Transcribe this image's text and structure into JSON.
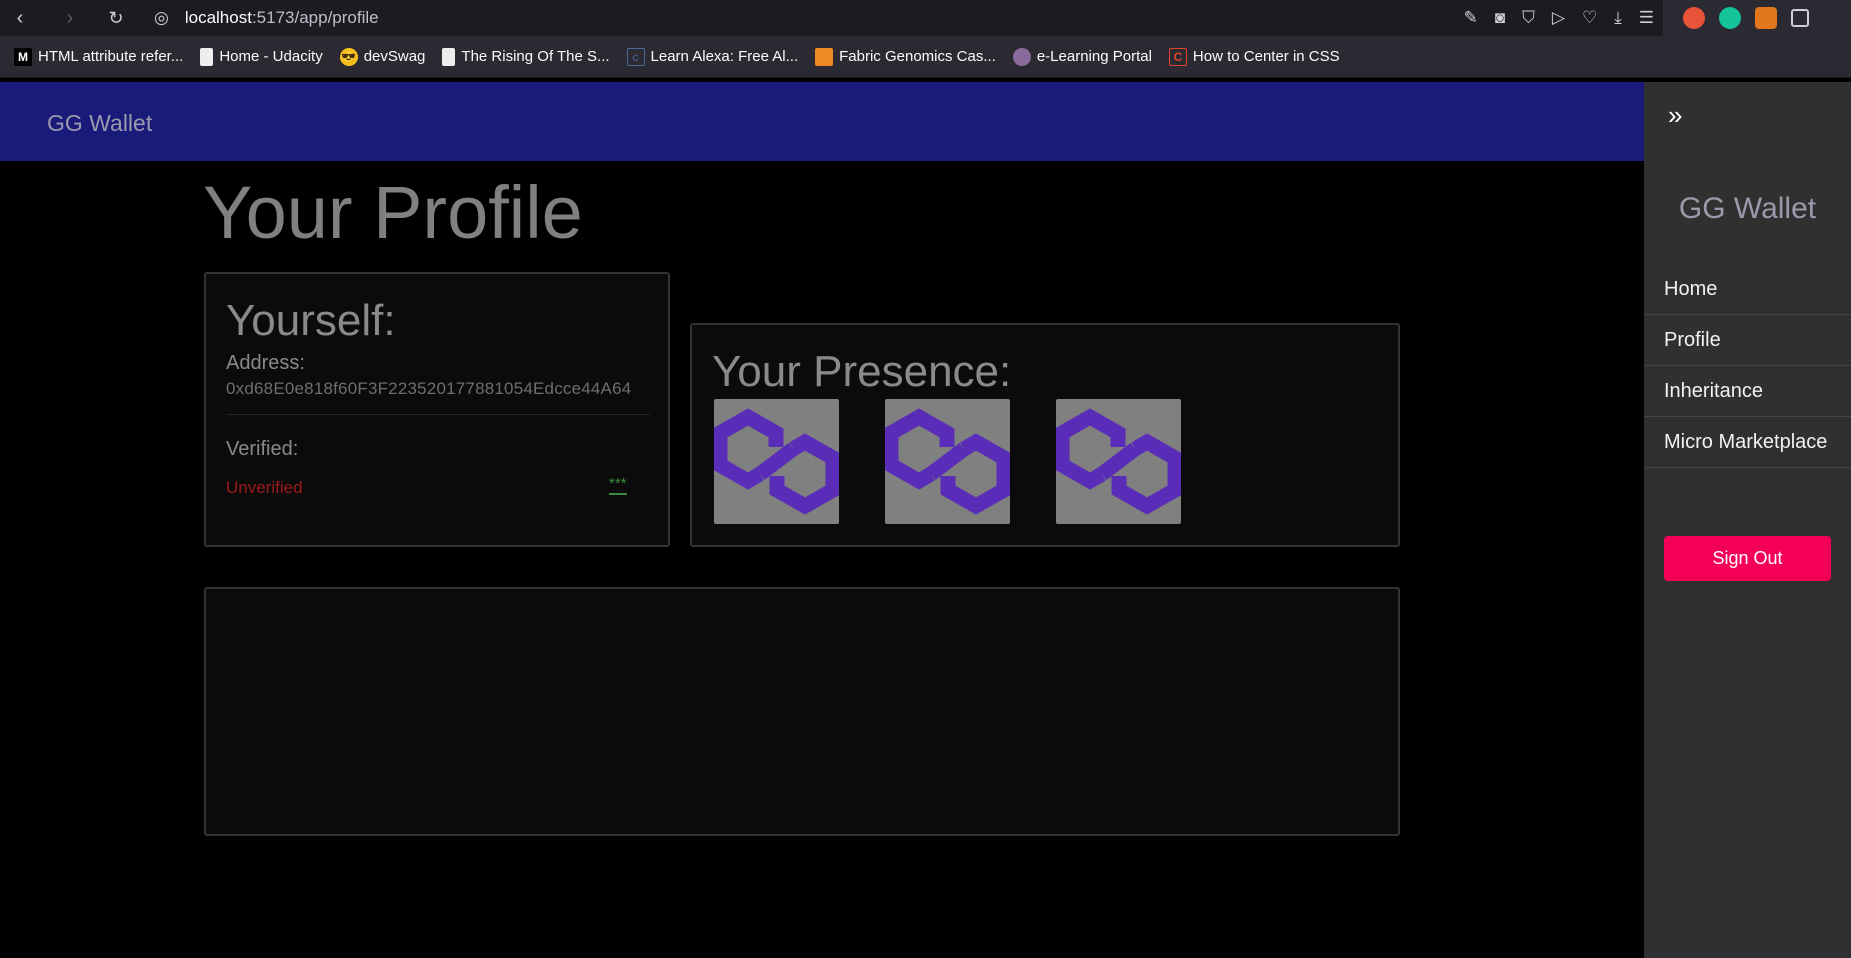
{
  "browser": {
    "url_host": "localhost",
    "url_path": ":5173/app/profile",
    "bookmarks": [
      "HTML attribute refer...",
      "Home - Udacity",
      "devSwag",
      "The Rising Of The S...",
      "Learn Alexa: Free Al...",
      "Fabric Genomics Cas...",
      "e-Learning Portal",
      "How to Center in CSS"
    ]
  },
  "header": {
    "brand": "GG Wallet"
  },
  "main": {
    "title": "Your Profile",
    "yourself": {
      "title": "Yourself:",
      "address_label": "Address:",
      "address_value": "0xd68E0e818f60F3F223520177881054Edcce44A64",
      "verified_label": "Verified:",
      "status": "Unverified",
      "stars": "***"
    },
    "presence": {
      "title": "Your Presence:",
      "items": [
        "polygon-logo",
        "polygon-logo",
        "polygon-logo"
      ]
    }
  },
  "sidebar": {
    "brand": "GG Wallet",
    "items": [
      "Home",
      "Profile",
      "Inheritance",
      "Micro Marketplace"
    ],
    "sign_out": "Sign Out"
  },
  "colors": {
    "header_bg": "#1a1a7a",
    "sign_out_bg": "#f50057",
    "unverified": "#9e1a1a",
    "polygon_purple": "#5a2db8"
  }
}
